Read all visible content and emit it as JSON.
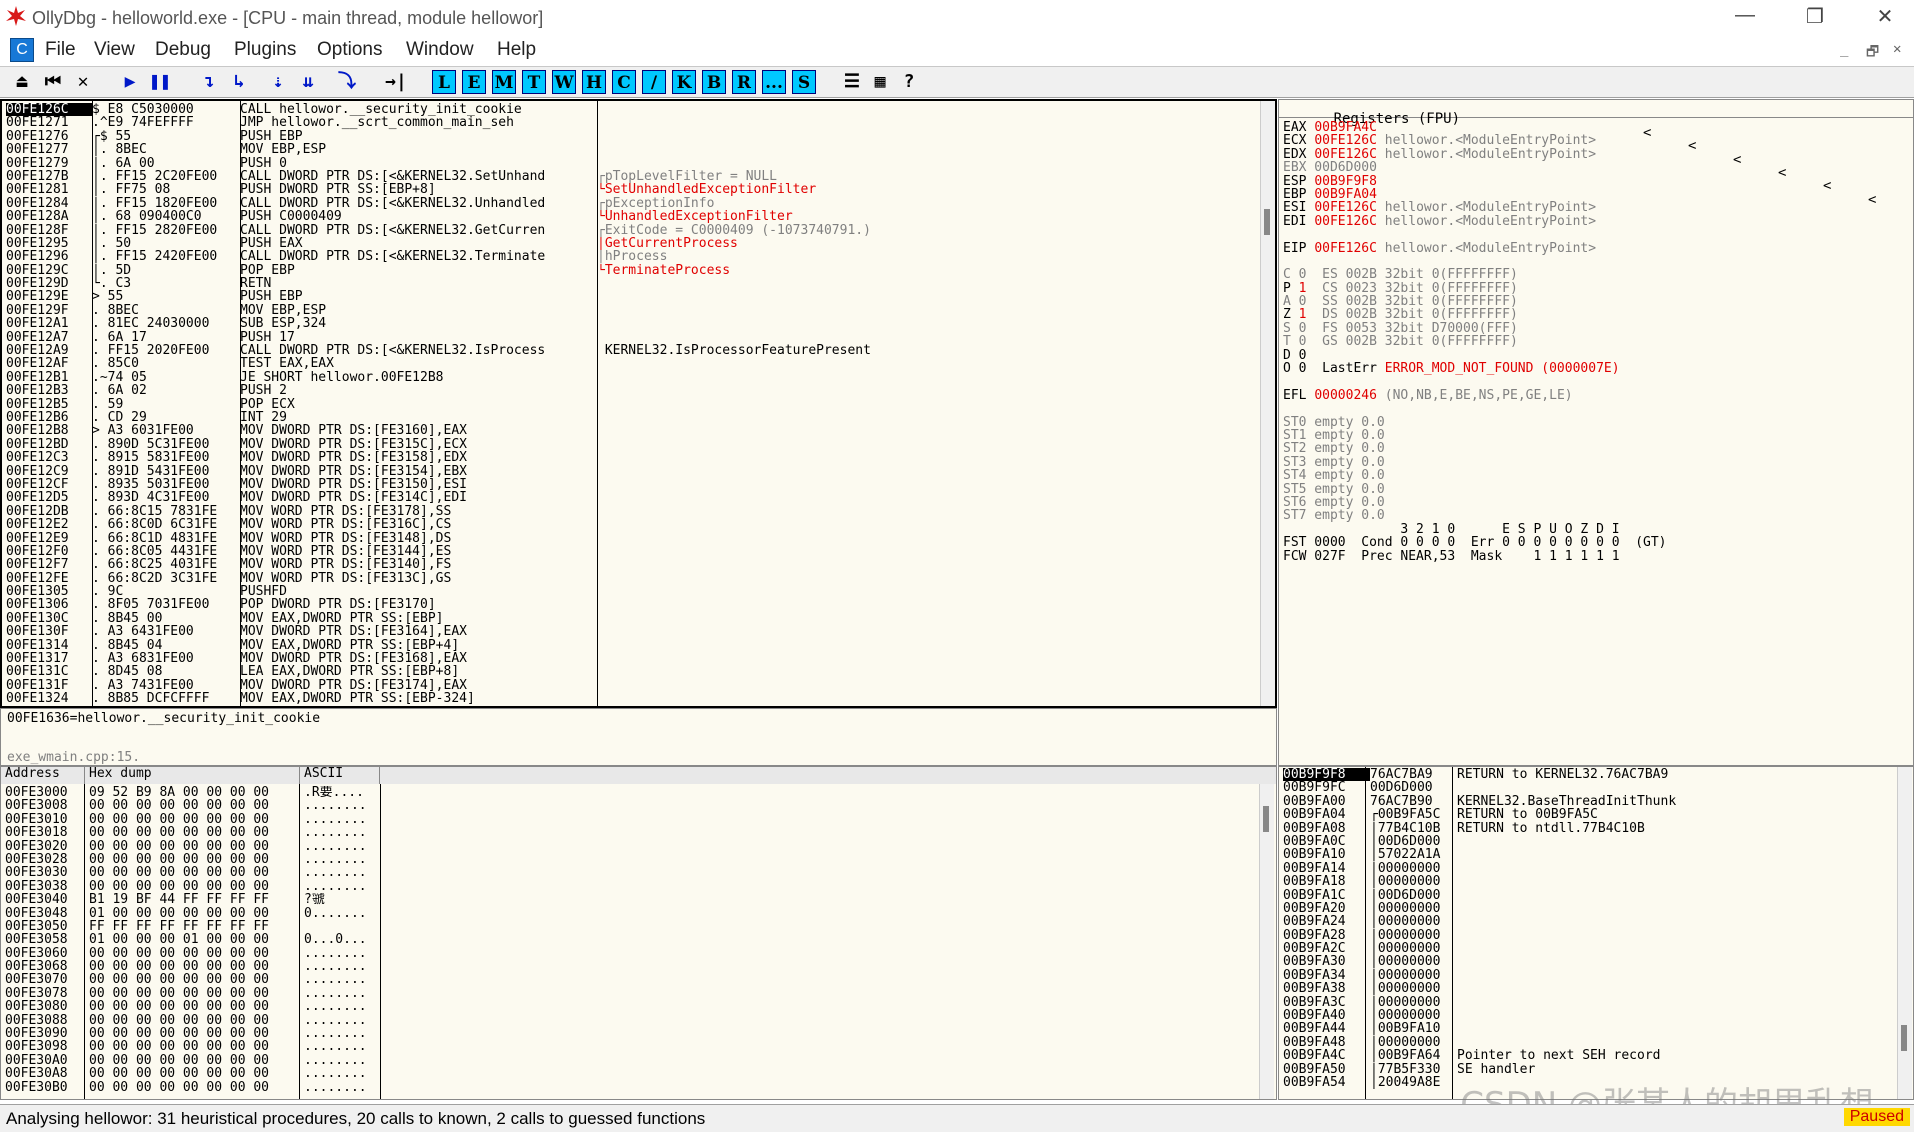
{
  "window": {
    "title": "OllyDbg - helloworld.exe - [CPU - main thread, module hellowor]",
    "minimize": "—",
    "maximize": "❐",
    "close": "✕"
  },
  "menu": {
    "icon": "C",
    "items": [
      "File",
      "View",
      "Debug",
      "Plugins",
      "Options",
      "Window",
      "Help"
    ],
    "mdi": [
      "_",
      "🗗",
      "✕"
    ]
  },
  "toolbar": {
    "left": [
      "⏏",
      "⏮",
      "✕",
      "▶",
      "❚❚",
      "↴",
      "↳",
      "⇣",
      "⇊",
      "⤵",
      "→|"
    ],
    "letters": [
      "L",
      "E",
      "M",
      "T",
      "W",
      "H",
      "C",
      "/",
      "K",
      "B",
      "R",
      "...",
      "S"
    ],
    "right": [
      "☰",
      "▦",
      "?"
    ]
  },
  "disasm": {
    "rows": [
      [
        "00FE126C",
        "$ E8 C5030000",
        "CALL hellowor.__security_init_cookie",
        ""
      ],
      [
        "00FE1271",
        ".^E9 74FEFFFF",
        "JMP hellowor.__scrt_common_main_seh",
        ""
      ],
      [
        "00FE1276",
        "┌$ 55",
        "PUSH EBP",
        ""
      ],
      [
        "00FE1277",
        "│. 8BEC",
        "MOV EBP,ESP",
        ""
      ],
      [
        "00FE1279",
        "│. 6A 00",
        "PUSH 0",
        ""
      ],
      [
        "00FE127B",
        "│. FF15 2C20FE00",
        "CALL DWORD PTR DS:[<&KERNEL32.SetUnhand",
        "┌pTopLevelFilter = NULL"
      ],
      [
        "00FE1281",
        "│. FF75 08",
        "PUSH DWORD PTR SS:[EBP+8]",
        "└SetUnhandledExceptionFilter"
      ],
      [
        "00FE1284",
        "│. FF15 1820FE00",
        "CALL DWORD PTR DS:[<&KERNEL32.Unhandled",
        "┌pExceptionInfo"
      ],
      [
        "00FE128A",
        "│. 68 090400C0",
        "PUSH C0000409",
        "└UnhandledExceptionFilter"
      ],
      [
        "00FE128F",
        "│. FF15 2820FE00",
        "CALL DWORD PTR DS:[<&KERNEL32.GetCurren",
        "┌ExitCode = C0000409 (-1073740791.)"
      ],
      [
        "00FE1295",
        "│. 50",
        "PUSH EAX",
        "│GetCurrentProcess"
      ],
      [
        "00FE1296",
        "│. FF15 2420FE00",
        "CALL DWORD PTR DS:[<&KERNEL32.Terminate",
        "│hProcess"
      ],
      [
        "00FE129C",
        "│. 5D",
        "POP EBP",
        "└TerminateProcess"
      ],
      [
        "00FE129D",
        "└. C3",
        "RETN",
        ""
      ],
      [
        "00FE129E",
        "> 55",
        "PUSH EBP",
        ""
      ],
      [
        "00FE129F",
        ". 8BEC",
        "MOV EBP,ESP",
        ""
      ],
      [
        "00FE12A1",
        ". 81EC 24030000",
        "SUB ESP,324",
        ""
      ],
      [
        "00FE12A7",
        ". 6A 17",
        "PUSH 17",
        ""
      ],
      [
        "00FE12A9",
        ". FF15 2020FE00",
        "CALL DWORD PTR DS:[<&KERNEL32.IsProcess",
        " KERNEL32.IsProcessorFeaturePresent"
      ],
      [
        "00FE12AF",
        ". 85C0",
        "TEST EAX,EAX",
        ""
      ],
      [
        "00FE12B1",
        ".~74 05",
        "JE SHORT hellowor.00FE12B8",
        ""
      ],
      [
        "00FE12B3",
        ". 6A 02",
        "PUSH 2",
        ""
      ],
      [
        "00FE12B5",
        ". 59",
        "POP ECX",
        ""
      ],
      [
        "00FE12B6",
        ". CD 29",
        "INT 29",
        ""
      ],
      [
        "00FE12B8",
        "> A3 6031FE00",
        "MOV DWORD PTR DS:[FE3160],EAX",
        ""
      ],
      [
        "00FE12BD",
        ". 890D 5C31FE00",
        "MOV DWORD PTR DS:[FE315C],ECX",
        ""
      ],
      [
        "00FE12C3",
        ". 8915 5831FE00",
        "MOV DWORD PTR DS:[FE3158],EDX",
        ""
      ],
      [
        "00FE12C9",
        ". 891D 5431FE00",
        "MOV DWORD PTR DS:[FE3154],EBX",
        ""
      ],
      [
        "00FE12CF",
        ". 8935 5031FE00",
        "MOV DWORD PTR DS:[FE3150],ESI",
        ""
      ],
      [
        "00FE12D5",
        ". 893D 4C31FE00",
        "MOV DWORD PTR DS:[FE314C],EDI",
        ""
      ],
      [
        "00FE12DB",
        ". 66:8C15 7831FE",
        "MOV WORD PTR DS:[FE3178],SS",
        ""
      ],
      [
        "00FE12E2",
        ". 66:8C0D 6C31FE",
        "MOV WORD PTR DS:[FE316C],CS",
        ""
      ],
      [
        "00FE12E9",
        ". 66:8C1D 4831FE",
        "MOV WORD PTR DS:[FE3148],DS",
        ""
      ],
      [
        "00FE12F0",
        ". 66:8C05 4431FE",
        "MOV WORD PTR DS:[FE3144],ES",
        ""
      ],
      [
        "00FE12F7",
        ". 66:8C25 4031FE",
        "MOV WORD PTR DS:[FE3140],FS",
        ""
      ],
      [
        "00FE12FE",
        ". 66:8C2D 3C31FE",
        "MOV WORD PTR DS:[FE313C],GS",
        ""
      ],
      [
        "00FE1305",
        ". 9C",
        "PUSHFD",
        ""
      ],
      [
        "00FE1306",
        ". 8F05 7031FE00",
        "POP DWORD PTR DS:[FE3170]",
        ""
      ],
      [
        "00FE130C",
        ". 8B45 00",
        "MOV EAX,DWORD PTR SS:[EBP]",
        ""
      ],
      [
        "00FE130F",
        ". A3 6431FE00",
        "MOV DWORD PTR DS:[FE3164],EAX",
        ""
      ],
      [
        "00FE1314",
        ". 8B45 04",
        "MOV EAX,DWORD PTR SS:[EBP+4]",
        ""
      ],
      [
        "00FE1317",
        ". A3 6831FE00",
        "MOV DWORD PTR DS:[FE3168],EAX",
        ""
      ],
      [
        "00FE131C",
        ". 8D45 08",
        "LEA EAX,DWORD PTR SS:[EBP+8]",
        ""
      ],
      [
        "00FE131F",
        ". A3 7431FE00",
        "MOV DWORD PTR DS:[FE3174],EAX",
        ""
      ],
      [
        "00FE1324",
        ". 8B85 DCFCFFFF",
        "MOV EAX,DWORD PTR SS:[EBP-324]",
        ""
      ]
    ]
  },
  "info": {
    "line1": "00FE1636=hellowor.__security_init_cookie",
    "line2": "exe_wmain.cpp:15."
  },
  "registers": {
    "header": "Registers (FPU)",
    "arrows": [
      "<",
      "<",
      "<",
      "<",
      "<",
      "<"
    ],
    "lines": [
      "EAX 00B9FA4C",
      "ECX 00FE126C hellowor.<ModuleEntryPoint>",
      "EDX 00FE126C hellowor.<ModuleEntryPoint>",
      "EBX 00D6D000",
      "ESP 00B9F9F8",
      "EBP 00B9FA04",
      "ESI 00FE126C hellowor.<ModuleEntryPoint>",
      "EDI 00FE126C hellowor.<ModuleEntryPoint>",
      "",
      "EIP 00FE126C hellowor.<ModuleEntryPoint>",
      "",
      "C 0  ES 002B 32bit 0(FFFFFFFF)",
      "P 1  CS 0023 32bit 0(FFFFFFFF)",
      "A 0  SS 002B 32bit 0(FFFFFFFF)",
      "Z 1  DS 002B 32bit 0(FFFFFFFF)",
      "S 0  FS 0053 32bit D70000(FFF)",
      "T 0  GS 002B 32bit 0(FFFFFFFF)",
      "D 0",
      "O 0  LastErr ERROR_MOD_NOT_FOUND (0000007E)",
      "",
      "EFL 00000246 (NO,NB,E,BE,NS,PE,GE,LE)",
      "",
      "ST0 empty 0.0",
      "ST1 empty 0.0",
      "ST2 empty 0.0",
      "ST3 empty 0.0",
      "ST4 empty 0.0",
      "ST5 empty 0.0",
      "ST6 empty 0.0",
      "ST7 empty 0.0",
      "               3 2 1 0      E S P U O Z D I",
      "FST 0000  Cond 0 0 0 0  Err 0 0 0 0 0 0 0 0  (GT)",
      "FCW 027F  Prec NEAR,53  Mask    1 1 1 1 1 1"
    ]
  },
  "dump": {
    "headers": [
      "Address",
      "Hex dump",
      "ASCII"
    ],
    "rows": [
      [
        "00FE3000",
        "09 52 B9 8A 00 00 00 00",
        ".R要...."
      ],
      [
        "00FE3008",
        "00 00 00 00 00 00 00 00",
        "........"
      ],
      [
        "00FE3010",
        "00 00 00 00 00 00 00 00",
        "........"
      ],
      [
        "00FE3018",
        "00 00 00 00 00 00 00 00",
        "........"
      ],
      [
        "00FE3020",
        "00 00 00 00 00 00 00 00",
        "........"
      ],
      [
        "00FE3028",
        "00 00 00 00 00 00 00 00",
        "........"
      ],
      [
        "00FE3030",
        "00 00 00 00 00 00 00 00",
        "........"
      ],
      [
        "00FE3038",
        "00 00 00 00 00 00 00 00",
        "........"
      ],
      [
        "00FE3040",
        "B1 19 BF 44 FF FF FF FF",
        "?虢    "
      ],
      [
        "00FE3048",
        "01 00 00 00 00 00 00 00",
        "0......."
      ],
      [
        "00FE3050",
        "FF FF FF FF FF FF FF FF",
        "        "
      ],
      [
        "00FE3058",
        "01 00 00 00 01 00 00 00",
        "0...0..."
      ],
      [
        "00FE3060",
        "00 00 00 00 00 00 00 00",
        "........"
      ],
      [
        "00FE3068",
        "00 00 00 00 00 00 00 00",
        "........"
      ],
      [
        "00FE3070",
        "00 00 00 00 00 00 00 00",
        "........"
      ],
      [
        "00FE3078",
        "00 00 00 00 00 00 00 00",
        "........"
      ],
      [
        "00FE3080",
        "00 00 00 00 00 00 00 00",
        "........"
      ],
      [
        "00FE3088",
        "00 00 00 00 00 00 00 00",
        "........"
      ],
      [
        "00FE3090",
        "00 00 00 00 00 00 00 00",
        "........"
      ],
      [
        "00FE3098",
        "00 00 00 00 00 00 00 00",
        "........"
      ],
      [
        "00FE30A0",
        "00 00 00 00 00 00 00 00",
        "........"
      ],
      [
        "00FE30A8",
        "00 00 00 00 00 00 00 00",
        "........"
      ],
      [
        "00FE30B0",
        "00 00 00 00 00 00 00 00",
        "........"
      ]
    ]
  },
  "stack": {
    "rows": [
      [
        "00B9F9F8",
        "76AC7BA9",
        "RETURN to KERNEL32.76AC7BA9"
      ],
      [
        "00B9F9FC",
        "00D6D000",
        ""
      ],
      [
        "00B9FA00",
        "76AC7B90",
        "KERNEL32.BaseThreadInitThunk"
      ],
      [
        "00B9FA04",
        "┌00B9FA5C",
        "RETURN to 00B9FA5C"
      ],
      [
        "00B9FA08",
        "│77B4C10B",
        "RETURN to ntdll.77B4C10B"
      ],
      [
        "00B9FA0C",
        "│00D6D000",
        ""
      ],
      [
        "00B9FA10",
        "│57022A1A",
        ""
      ],
      [
        "00B9FA14",
        "│00000000",
        ""
      ],
      [
        "00B9FA18",
        "│00000000",
        ""
      ],
      [
        "00B9FA1C",
        "│00D6D000",
        ""
      ],
      [
        "00B9FA20",
        "│00000000",
        ""
      ],
      [
        "00B9FA24",
        "│00000000",
        ""
      ],
      [
        "00B9FA28",
        "│00000000",
        ""
      ],
      [
        "00B9FA2C",
        "│00000000",
        ""
      ],
      [
        "00B9FA30",
        "│00000000",
        ""
      ],
      [
        "00B9FA34",
        "│00000000",
        ""
      ],
      [
        "00B9FA38",
        "│00000000",
        ""
      ],
      [
        "00B9FA3C",
        "│00000000",
        ""
      ],
      [
        "00B9FA40",
        "│00000000",
        ""
      ],
      [
        "00B9FA44",
        "│00B9FA10",
        ""
      ],
      [
        "00B9FA48",
        "│00000000",
        ""
      ],
      [
        "00B9FA4C",
        "│00B9FA64",
        "Pointer to next SEH record"
      ],
      [
        "00B9FA50",
        "│77B5F330",
        "SE handler"
      ],
      [
        "00B9FA54",
        "│20049A8E",
        ""
      ]
    ]
  },
  "status": {
    "text": "Analysing hellowor: 31 heuristical procedures, 20 calls to known, 2 calls to guessed functions",
    "state": "Paused"
  },
  "watermark": "CSDN @张某人的胡思乱想"
}
